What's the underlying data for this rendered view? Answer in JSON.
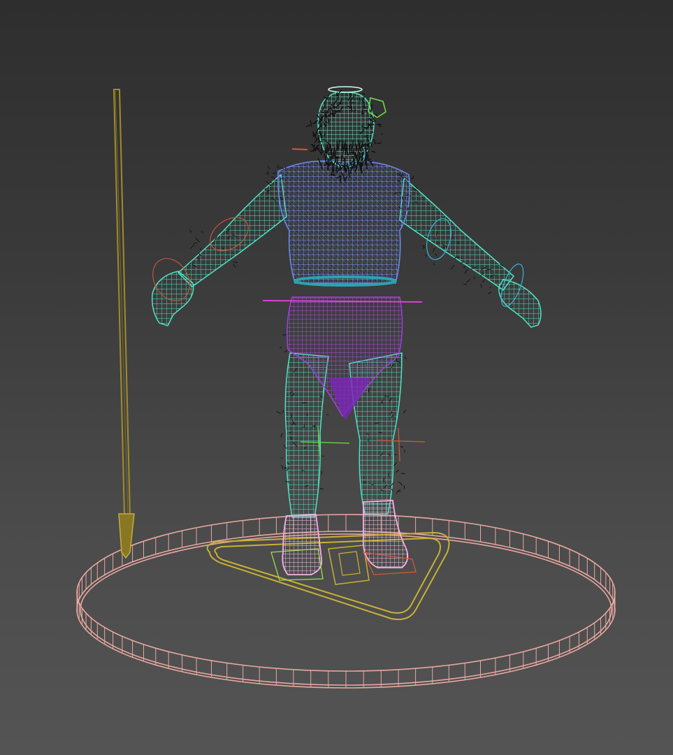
{
  "viewport": {
    "mode": "wireframe",
    "background_top": "#2e2e2e",
    "background_bottom": "#545454"
  },
  "scene": {
    "objects": [
      {
        "name": "character-body",
        "kind": "mesh",
        "color": "#4fe3c4"
      },
      {
        "name": "shirt",
        "kind": "mesh",
        "color": "#6b8cf5"
      },
      {
        "name": "loincloth",
        "kind": "mesh",
        "color": "#9b59e8"
      },
      {
        "name": "boots",
        "kind": "mesh",
        "color": "#f5b0e6"
      },
      {
        "name": "hair-beard",
        "kind": "hair",
        "color": "#111111"
      },
      {
        "name": "spear",
        "kind": "mesh",
        "color": "#9c8a2a"
      },
      {
        "name": "base-disc",
        "kind": "mesh",
        "color": "#e9a8a0"
      },
      {
        "name": "root-control",
        "kind": "helper",
        "color": "#c9b134"
      },
      {
        "name": "rig-controls",
        "kind": "helper",
        "color": "#d05a3a"
      }
    ]
  },
  "colors": {
    "skin": "#4fe3c4",
    "shirt": "#6b8cf5",
    "cloth": "#a23ee0",
    "boots": "#f5b0e6",
    "spear": "#a08b2c",
    "disc": "#e9a8a0",
    "root": "#c9b134",
    "ctrl_red": "#c2553a",
    "ctrl_cyan": "#38b6d8",
    "ctrl_green": "#6fe04a",
    "ctrl_magenta": "#e040d0"
  }
}
